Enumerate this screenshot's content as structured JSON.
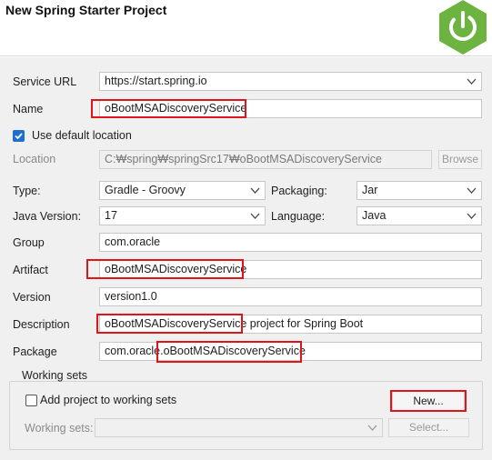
{
  "header": {
    "title": "New Spring Starter Project",
    "logo_icon": "spring-power-icon",
    "logo_color": "#6db33f"
  },
  "form": {
    "service_url": {
      "label": "Service URL",
      "value": "https://start.spring.io"
    },
    "name": {
      "label": "Name",
      "value": "oBootMSADiscoveryService"
    },
    "use_default_location": {
      "label": "Use default location",
      "checked": true
    },
    "location": {
      "label": "Location",
      "value": "C:₩spring₩springSrc17₩oBootMSADiscoveryService",
      "browse_label": "Browse"
    },
    "type": {
      "label": "Type:",
      "value": "Gradle - Groovy"
    },
    "packaging": {
      "label": "Packaging:",
      "value": "Jar"
    },
    "java_version": {
      "label": "Java Version:",
      "value": "17"
    },
    "language": {
      "label": "Language:",
      "value": "Java"
    },
    "group": {
      "label": "Group",
      "value": "com.oracle"
    },
    "artifact": {
      "label": "Artifact",
      "value": "oBootMSADiscoveryService"
    },
    "version": {
      "label": "Version",
      "value": "version1.0"
    },
    "description": {
      "label": "Description",
      "value_highlight": "oBootMSADiscoveryService",
      "value_rest": " project for Spring Boot"
    },
    "package": {
      "label": "Package",
      "value_prefix": "com.oracle.",
      "value_highlight": "oBootMSADiscoveryService"
    }
  },
  "working_sets": {
    "title": "Working sets",
    "add_checkbox": {
      "label": "Add project to working sets",
      "checked": false
    },
    "new_button": "New...",
    "sets_label": "Working sets:",
    "sets_value": "",
    "select_button": "Select..."
  },
  "colors": {
    "accent": "#1e6fd0",
    "highlight": "#e0151b",
    "dialog_bg": "#f0f0f0"
  }
}
